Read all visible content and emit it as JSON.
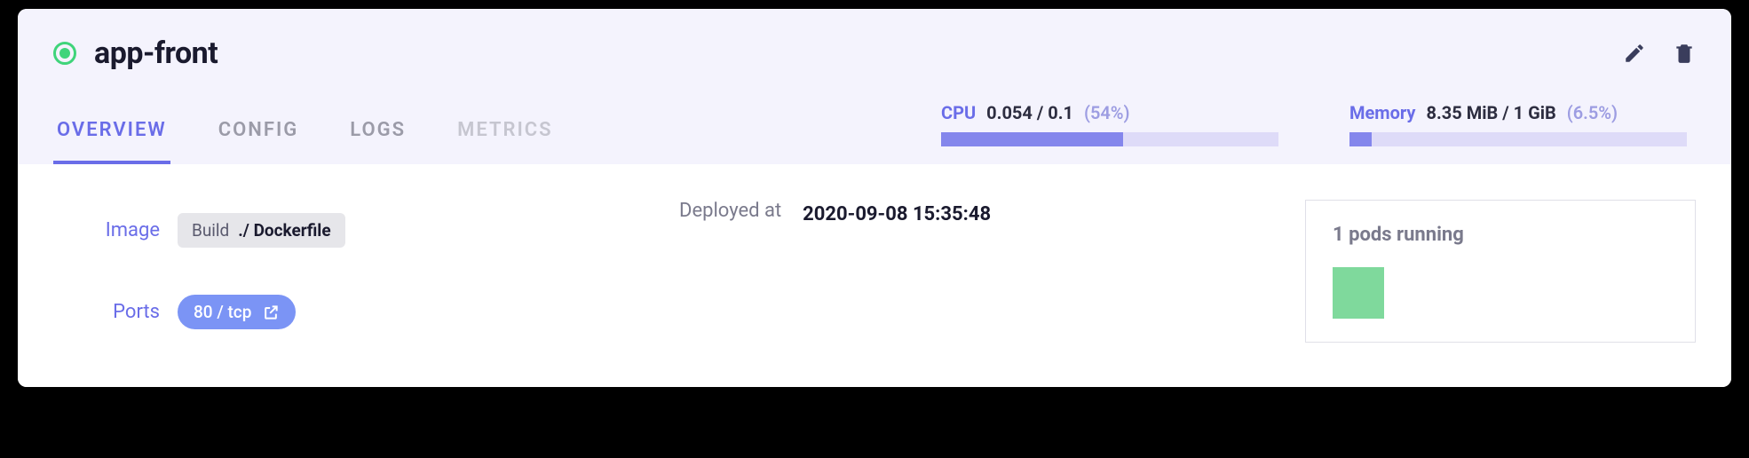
{
  "app": {
    "name": "app-front",
    "status": "running"
  },
  "tabs": [
    {
      "label": "OVERVIEW",
      "state": "active"
    },
    {
      "label": "CONFIG",
      "state": "normal"
    },
    {
      "label": "LOGS",
      "state": "normal"
    },
    {
      "label": "METRICS",
      "state": "disabled"
    }
  ],
  "metrics": {
    "cpu": {
      "name": "CPU",
      "value": "0.054 / 0.1",
      "pct_label": "(54%)",
      "pct": 54
    },
    "memory": {
      "name": "Memory",
      "value": "8.35 MiB / 1 GiB",
      "pct_label": "(6.5%)",
      "pct": 6.5
    }
  },
  "overview": {
    "image": {
      "label": "Image",
      "build_label": "Build",
      "path": "./ Dockerfile"
    },
    "ports": {
      "label": "Ports",
      "chip": "80 / tcp"
    },
    "deployed": {
      "label": "Deployed at",
      "value": "2020-09-08 15:35:48"
    },
    "pods": {
      "title": "1 pods running",
      "count": 1
    }
  },
  "icons": {
    "edit": "edit-icon",
    "delete": "trash-icon",
    "open": "open-external-icon"
  }
}
